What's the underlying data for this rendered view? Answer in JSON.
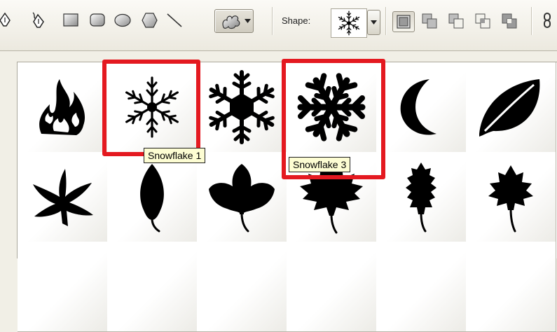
{
  "toolbar": {
    "tools": [
      {
        "name": "pen-tool-icon"
      },
      {
        "name": "freeform-pen-tool-icon"
      },
      {
        "name": "rectangle-tool-icon"
      },
      {
        "name": "rounded-rectangle-tool-icon"
      },
      {
        "name": "ellipse-tool-icon"
      },
      {
        "name": "polygon-tool-icon"
      },
      {
        "name": "line-tool-icon"
      },
      {
        "name": "custom-shape-tool-icon",
        "selected": true
      }
    ],
    "shape_label": "Shape:",
    "shape_preview_icon": "snowflake-1-icon",
    "mode_buttons": [
      {
        "name": "create-new-shape-layer-icon",
        "active": true
      },
      {
        "name": "add-to-shape-area-icon"
      },
      {
        "name": "subtract-from-shape-area-icon"
      },
      {
        "name": "intersect-shape-areas-icon"
      },
      {
        "name": "exclude-overlapping-shape-areas-icon"
      }
    ]
  },
  "shape_grid": {
    "rows": [
      [
        "fire",
        "snowflake-1",
        "snowflake-2",
        "snowflake-3",
        "moon",
        "leaf-1"
      ],
      [
        "leaf-2",
        "leaf-3",
        "leaf-4",
        "leaf-5",
        "leaf-6",
        "leaf-7"
      ]
    ],
    "highlight_color": "#e41920",
    "tooltips": [
      {
        "shape": "snowflake-1",
        "text": "Snowflake 1"
      },
      {
        "shape": "snowflake-3",
        "text": "Snowflake 3"
      }
    ]
  }
}
